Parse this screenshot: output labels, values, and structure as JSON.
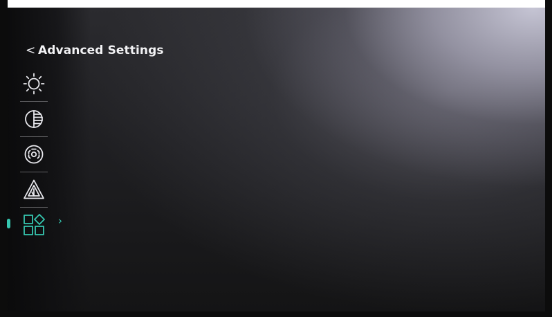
{
  "header": {
    "back_icon": "chevron-left-icon",
    "back_glyph": "<",
    "title": "Advanced Settings"
  },
  "menu": {
    "items": [
      {
        "id": "brightness",
        "icon": "brightness-sun-icon",
        "active": false
      },
      {
        "id": "contrast",
        "icon": "contrast-half-circle-icon",
        "active": false
      },
      {
        "id": "sharpness",
        "icon": "sharpness-focus-icon",
        "active": false
      },
      {
        "id": "warning",
        "icon": "warning-triangle-icon",
        "active": false
      },
      {
        "id": "more",
        "icon": "apps-grid-diamond-icon",
        "active": true
      }
    ],
    "expand_glyph": "›"
  },
  "colors": {
    "accent": "#36c7b0",
    "icon_default": "#e9e9ee",
    "text": "#f2f2f4"
  }
}
